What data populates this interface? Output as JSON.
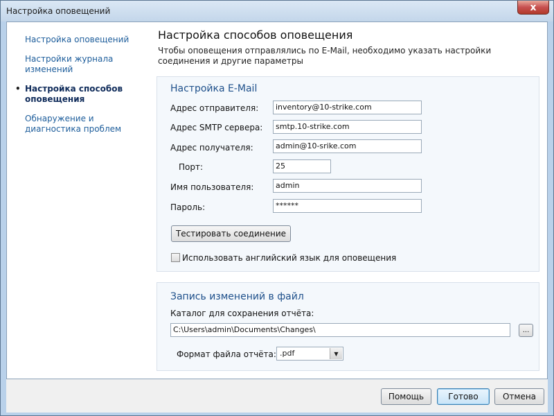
{
  "window": {
    "title": "Настройка оповещений",
    "close_glyph": "x"
  },
  "nav": {
    "items": [
      {
        "label": "Настройка оповещений",
        "active": false
      },
      {
        "label": "Настройки журнала изменений",
        "active": false
      },
      {
        "label": "Настройка способов оповещения",
        "active": true
      },
      {
        "label": "Обнаружение и диагностика проблем",
        "active": false
      }
    ],
    "bullet": "•"
  },
  "main": {
    "title": "Настройка способов оповещения",
    "description": "Чтобы оповещения отправлялись по E-Mail, необходимо указать настройки соединения и другие параметры"
  },
  "email": {
    "group_title": "Настройка E-Mail",
    "sender_label": "Адрес отправителя:",
    "sender_value": "inventory@10-strike.com",
    "smtp_label": "Адрес SMTP сервера:",
    "smtp_value": "smtp.10-strike.com",
    "recipient_label": "Адрес получателя:",
    "recipient_value": "admin@10-srike.com",
    "port_label": "Порт:",
    "port_value": "25",
    "username_label": "Имя пользователя:",
    "username_value": "admin",
    "password_label": "Пароль:",
    "password_value": "******",
    "test_button": "Тестировать соединение",
    "english_checkbox_label": "Использовать английский язык для оповещения",
    "english_checked": false
  },
  "file_log": {
    "group_title": "Запись изменений в файл",
    "folder_label": "Каталог для сохранения отчёта:",
    "folder_value": "C:\\Users\\admin\\Documents\\Changes\\",
    "browse_button": "...",
    "format_label": "Формат файла отчёта:",
    "format_value": ".pdf"
  },
  "footer": {
    "help_button": "Помощь",
    "done_button": "Готово",
    "cancel_button": "Отмена"
  },
  "colors": {
    "link": "#1d5d9b",
    "group_title": "#1d4f8a",
    "close": "#c75050"
  }
}
